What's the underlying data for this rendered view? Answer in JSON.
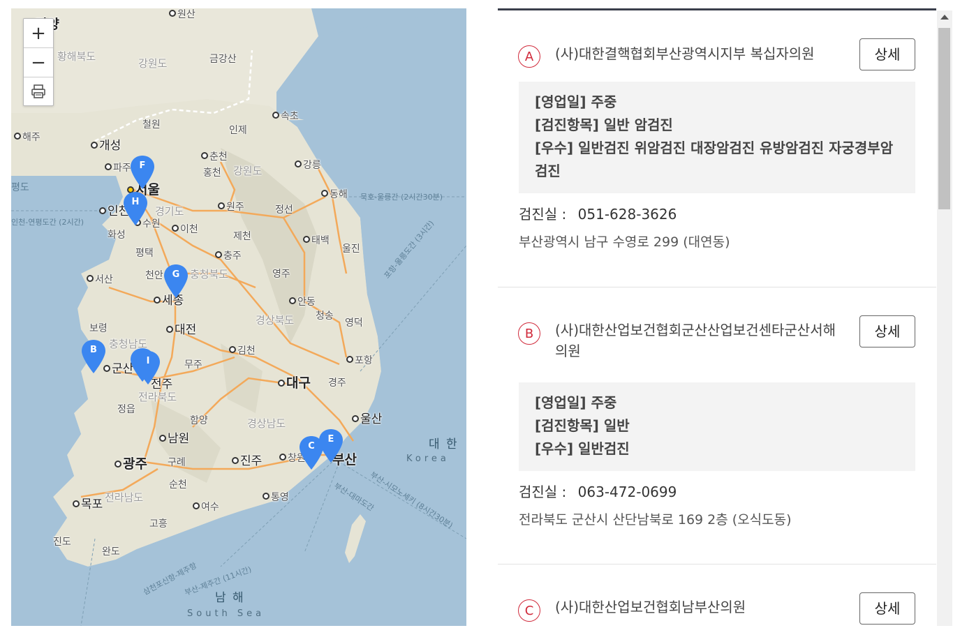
{
  "map": {
    "zoom_in_label": "+",
    "zoom_out_label": "−",
    "print_icon": "printer-icon",
    "places": {
      "pyongyang": "평양",
      "wonsan": "원산",
      "hwanghae": "황해북도",
      "gangwon_n": "강원도",
      "geumgang": "금강산",
      "haeju": "해주",
      "gaeseong": "개성",
      "cheorwon": "철원",
      "inje": "인제",
      "sokcho": "속초",
      "chuncheon": "춘천",
      "hongcheon": "홍천",
      "gangwon_s": "강원도",
      "gangneung": "강릉",
      "paju": "파주",
      "seoul": "서울",
      "donghae": "동해",
      "incheon": "인천",
      "gyeonggi": "경기도",
      "wonju": "원주",
      "jeongseon": "정선",
      "suwon": "수원",
      "icheon": "이천",
      "hwaseong": "화성",
      "jecheon": "제천",
      "taebaek": "태백",
      "uljin": "울진",
      "pyeongtaek": "평택",
      "chungju": "충주",
      "seosan": "서산",
      "cheonan": "천안",
      "chungbuk": "충청북도",
      "yeongju": "영주",
      "sejong": "세종",
      "andong": "안동",
      "daejeon": "대전",
      "gyeongbuk": "경상북도",
      "cheongsong": "청송",
      "yeongdeok": "영덕",
      "boryeong": "보령",
      "chungnam": "충청남도",
      "gimcheon": "김천",
      "gunsan": "군산",
      "muju": "무주",
      "pohang": "포항",
      "jeonju": "전주",
      "daegu": "대구",
      "gyeongju": "경주",
      "jeonbuk": "전라북도",
      "jeongeup": "정읍",
      "hamyang": "함양",
      "gyeongnam": "경상남도",
      "ulsan": "울산",
      "namwon": "남원",
      "gwangju": "광주",
      "gurye": "구례",
      "jinju": "진주",
      "changwon": "창원",
      "busan": "부산",
      "suncheon": "순천",
      "mokpo": "목포",
      "jeonnam": "전라남도",
      "yeosu": "여수",
      "tongyeong": "통영",
      "goheung": "고흥",
      "jindo": "진도",
      "wando": "완도",
      "namhae_sea": "남 해",
      "south_sea": "South Sea",
      "daehan": "대 한",
      "korea": "Korea",
      "pyeongdo": "평도"
    },
    "routes": {
      "mukho": "묵호-울릉간 (2시간30분)",
      "pohang_ferry": "포항-울릉도간 (3시간)",
      "busan_shimo": "부산-시모노세키 (8시간30분)",
      "busan_jeju": "부산-제주간 (11시간)",
      "busan_daema": "부산-대마도간",
      "jeju_route": "삼천포신항-제주항",
      "incheon_route": "인천-연평도간 (2시간)"
    },
    "markers": [
      "A",
      "B",
      "C",
      "E",
      "F",
      "G",
      "H",
      "I"
    ],
    "marker_color": "#3b86f0"
  },
  "list": {
    "detail_label": "상세",
    "phone_label": "검진실 :",
    "items": [
      {
        "letter": "A",
        "name": "(사)대한결핵협회부산광역시지부 복십자의원",
        "info": [
          "[영업일] 주중",
          "[검진항목] 일반 암검진",
          "[우수] 일반검진 위암검진 대장암검진 유방암검진 자궁경부암검진"
        ],
        "phone": "051-628-3626",
        "address": "부산광역시 남구 수영로 299 (대연동)"
      },
      {
        "letter": "B",
        "name": "(사)대한산업보건협회군산산업보건센타군산서해의원",
        "info": [
          "[영업일] 주중",
          "[검진항목] 일반",
          "[우수] 일반검진"
        ],
        "phone": "063-472-0699",
        "address": "전라북도 군산시 산단남북로 169 2층 (오식도동)"
      },
      {
        "letter": "C",
        "name": "(사)대한산업보건협회남부산의원"
      }
    ]
  },
  "colors": {
    "badge": "#d0293a",
    "sea": "#a5c2d8",
    "land": "#e8e6d8",
    "road": "#f3a95a",
    "header_rule": "#3a3f4b"
  }
}
